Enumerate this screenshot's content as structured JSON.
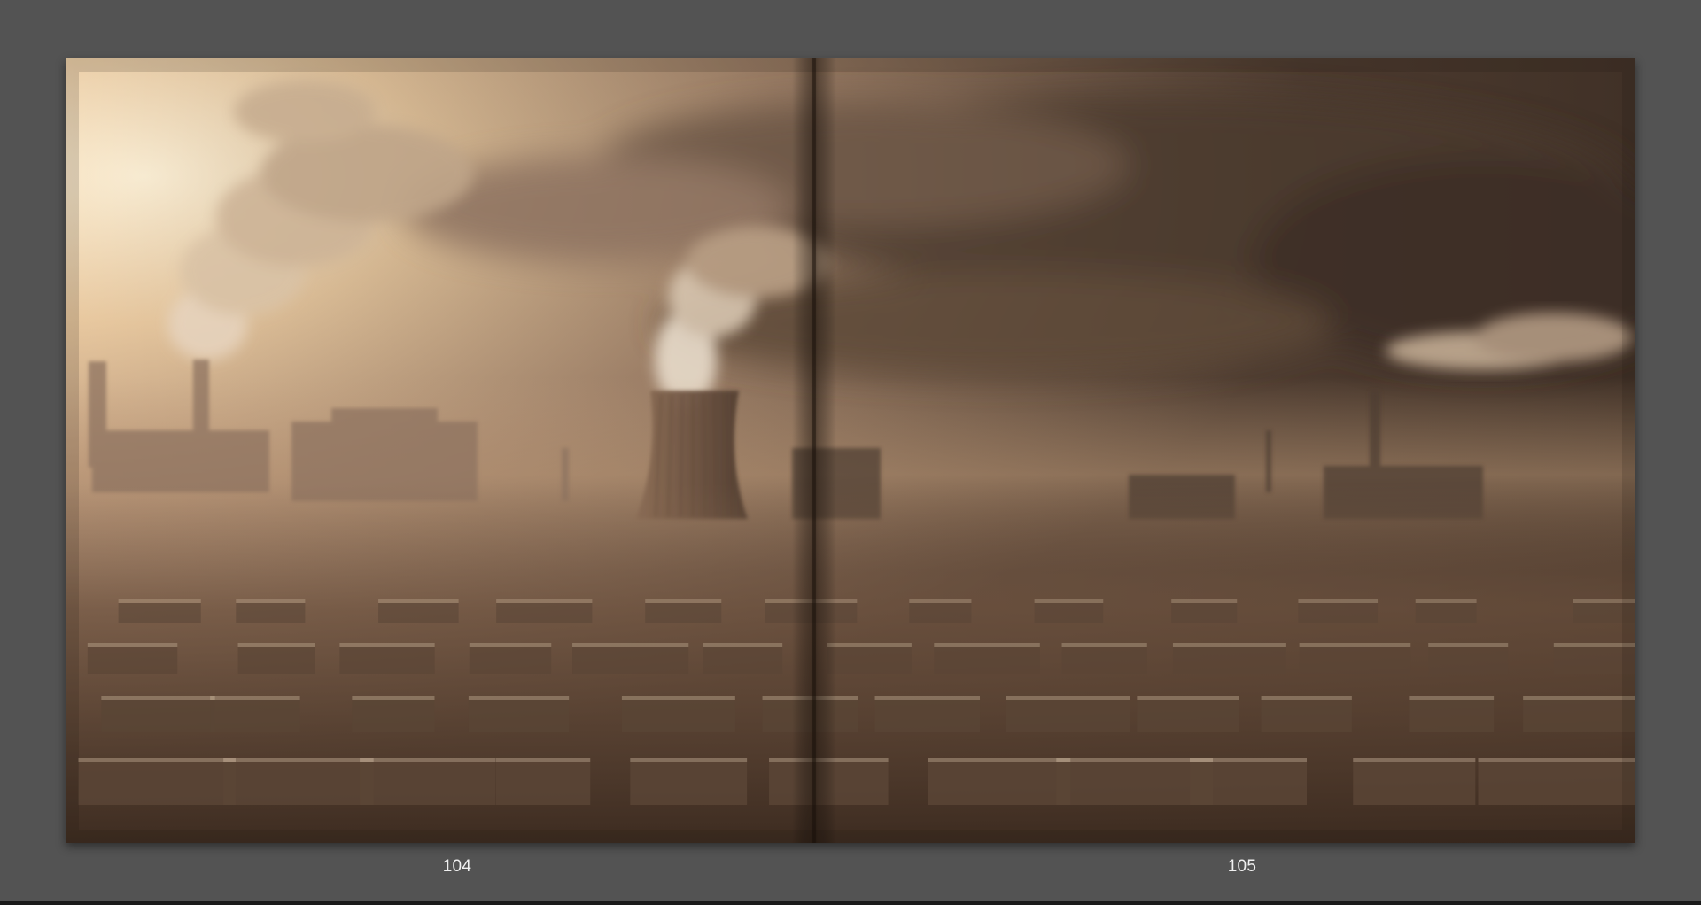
{
  "spread": {
    "left_page": {
      "number": "104"
    },
    "right_page": {
      "number": "105"
    },
    "photo_subject": "smoggy-industrial-city-with-cooling-tower-and-smokestacks"
  },
  "colors": {
    "viewer_background": "#535353",
    "page_number_text": "#f0f0f0",
    "sky_highlight": "#fbe8c8",
    "haze_mid": "#a8876a",
    "shadow": "#3a2a20"
  }
}
